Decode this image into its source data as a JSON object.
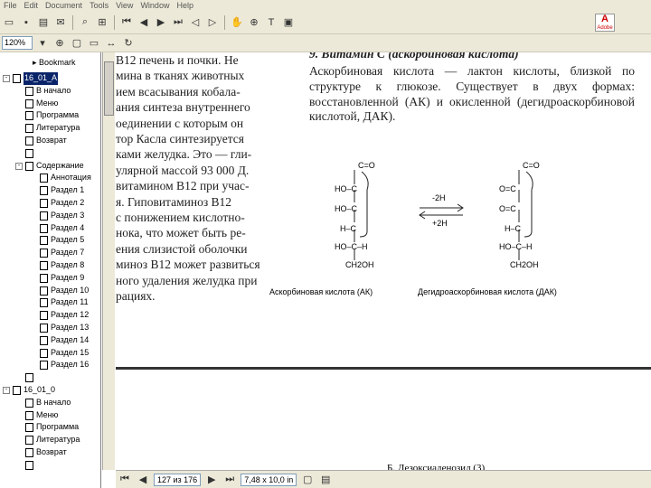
{
  "menu": [
    "File",
    "Edit",
    "Document",
    "Tools",
    "View",
    "Window",
    "Help"
  ],
  "toolbar": {
    "zoom": "120%"
  },
  "adobe_logo": "Adobe",
  "bookmark_tab": "Bookmark",
  "tree": [
    {
      "label": "16_01_A",
      "level": 0,
      "expand": "-",
      "selected": true
    },
    {
      "label": "В начало",
      "level": 1
    },
    {
      "label": "Меню",
      "level": 1
    },
    {
      "label": "Программа",
      "level": 1
    },
    {
      "label": "Литература",
      "level": 1
    },
    {
      "label": "Возврат",
      "level": 1
    },
    {
      "label": "",
      "level": 1
    },
    {
      "label": "Содержание",
      "level": 1,
      "expand": "-"
    },
    {
      "label": "Аннотация",
      "level": 2
    },
    {
      "label": "Раздел 1",
      "level": 2
    },
    {
      "label": "Раздел 2",
      "level": 2
    },
    {
      "label": "Раздел 3",
      "level": 2
    },
    {
      "label": "Раздел 4",
      "level": 2
    },
    {
      "label": "Раздел 5",
      "level": 2
    },
    {
      "label": "Раздел 7",
      "level": 2
    },
    {
      "label": "Раздел 8",
      "level": 2
    },
    {
      "label": "Раздел 9",
      "level": 2
    },
    {
      "label": "Раздел 10",
      "level": 2
    },
    {
      "label": "Раздел 11",
      "level": 2
    },
    {
      "label": "Раздел 12",
      "level": 2
    },
    {
      "label": "Раздел 13",
      "level": 2
    },
    {
      "label": "Раздел 14",
      "level": 2
    },
    {
      "label": "Раздел 15",
      "level": 2
    },
    {
      "label": "Раздел 16",
      "level": 2
    },
    {
      "label": "",
      "level": 1
    },
    {
      "label": "16_01_0",
      "level": 0,
      "expand": "-"
    },
    {
      "label": "В начало",
      "level": 1
    },
    {
      "label": "Меню",
      "level": 1
    },
    {
      "label": "Программа",
      "level": 1
    },
    {
      "label": "Литература",
      "level": 1
    },
    {
      "label": "Возврат",
      "level": 1
    },
    {
      "label": "",
      "level": 1
    }
  ],
  "doc": {
    "left_lines": [
      "B12 печень и почки. Не",
      "мина в тканях животных",
      "ием всасывания кобала-",
      "ания синтеза внутреннего",
      "оединении с которым он",
      "тор Касла синтезируется",
      "ками желудка. Это — гли-",
      "улярной массой 93 000 Д.",
      "витамином B12 при учас-",
      "я. Гиповитаминоз B12",
      "с понижением кислотно-",
      "нока, что может быть ре-",
      "ения слизистой оболочки",
      "минoз B12 может развиться",
      "ного удаления желудка при",
      "рациях."
    ],
    "section_title": "9. Витамин С (аскорбиновая кислота)",
    "paragraph": "Аскорбиновая кислота — лактон кислоты, близкой по структуре к глюкозе. Существует в двух формах: восстановленной (АК) и окисленной (дегидроаскорбиновой кислотой, ДАК).",
    "figure": {
      "arrow_top": "-2H",
      "arrow_bottom": "+2H",
      "caption_left": "Аскорбиновая кислота (АК)",
      "caption_right": "Дегидроаскорбиновая кислота (ДАК)",
      "left_groups": [
        "HO–C",
        "HO–C",
        "H–C",
        "HO–C–H",
        "CH2OH"
      ],
      "right_groups": [
        "O=C",
        "O=C",
        "H–C",
        "HO–C–H",
        "CH2OH"
      ]
    },
    "next_section": "Б. Дезоксиаденозил (3)"
  },
  "status": {
    "page": "127 из 176",
    "size": "7,48 x 10,0 in"
  }
}
